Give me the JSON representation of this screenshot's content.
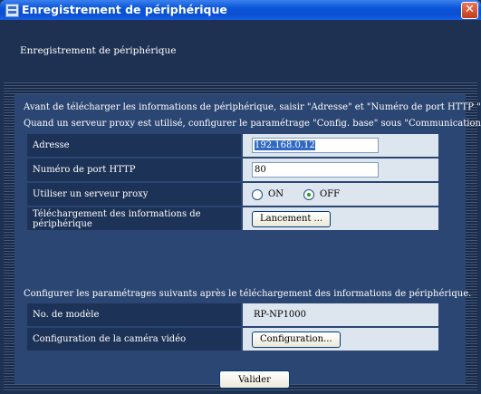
{
  "window": {
    "title": "Enregistrement de périphérique",
    "close_glyph": "✕"
  },
  "header": {
    "subtitle": "Enregistrement de périphérique"
  },
  "intro": {
    "line1": "Avant de télécharger les informations de périphérique, saisir \"Adresse\" et \"Numéro de port HTTP \".",
    "line2": "Quand un serveur proxy est utilisé, configurer le paramétrage \"Config. base\" sous \"Communication\"."
  },
  "form": {
    "address_label": "Adresse",
    "address_value": "192.168.0.12",
    "port_label": "Numéro de port HTTP",
    "port_value": "80",
    "proxy_label": "Utiliser un serveur proxy",
    "proxy_on": "ON",
    "proxy_off": "OFF",
    "proxy_selected": "OFF",
    "download_label": "Téléchargement des informations de périphérique",
    "download_button": "Lancement ..."
  },
  "after": {
    "note": "Configurer les paramétrages suivants après le téléchargement des informations de périphérique.",
    "model_label": "No. de modèle",
    "model_value": "RP-NP1000",
    "camera_label": "Configuration de la caméra vidéo",
    "camera_button": "Configuration..."
  },
  "footer": {
    "valider": "Valider"
  },
  "colors": {
    "titlebar": "#0b4fd0",
    "background": "#1e3152",
    "panel": "#2b4672",
    "label_cell": "#1d3257",
    "value_cell": "#dde5ee"
  },
  "icons": {
    "window_icon": "app-window-icon",
    "close": "close-icon"
  }
}
